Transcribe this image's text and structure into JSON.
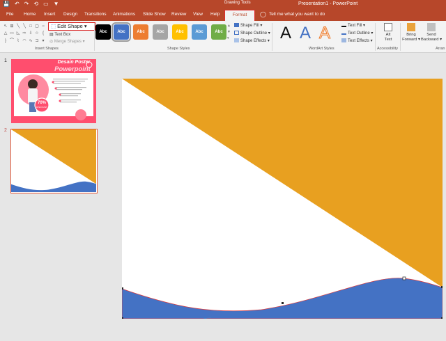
{
  "titlebar": {
    "qat": [
      "💾",
      "↶",
      "↷",
      "⟲",
      "▭",
      "▼"
    ],
    "tools_label": "Drawing Tools",
    "title": "Presentation1 - PowerPoint"
  },
  "tabs": [
    "File",
    "Home",
    "Insert",
    "Design",
    "Transitions",
    "Animations",
    "Slide Show",
    "Review",
    "View",
    "Help"
  ],
  "format_tab": "Format",
  "tell_me": "Tell me what you want to do",
  "ribbon": {
    "insert_shapes": {
      "label": "Insert Shapes",
      "edit_shape": "Edit Shape",
      "text_box": "Text Box",
      "merge_shapes": "Merge Shapes"
    },
    "shape_styles": {
      "label": "Shape Styles",
      "boxes": [
        {
          "text": "Abc",
          "color": "#000000"
        },
        {
          "text": "Abc",
          "color": "#4472c4",
          "selected": true
        },
        {
          "text": "Abc",
          "color": "#ed7d31"
        },
        {
          "text": "Abc",
          "color": "#a5a5a5"
        },
        {
          "text": "Abc",
          "color": "#ffc000"
        },
        {
          "text": "Abc",
          "color": "#5b9bd5"
        },
        {
          "text": "Abc",
          "color": "#70ad47"
        }
      ],
      "fill": "Shape Fill",
      "outline": "Shape Outline",
      "effects": "Shape Effects"
    },
    "wordart": {
      "label": "WordArt Styles",
      "samples": [
        "A",
        "A",
        "A"
      ],
      "text_fill": "Text Fill",
      "text_outline": "Text Outline",
      "text_effects": "Text Effects"
    },
    "accessibility": {
      "label": "Accessibility",
      "alt_text": [
        "Alt",
        "Text"
      ]
    },
    "arrange": {
      "label": "Arran",
      "bring_forward": [
        "Bring",
        "Forward"
      ],
      "send_backward": [
        "Send",
        "Backward"
      ]
    }
  },
  "slides": [
    {
      "number": "1",
      "title1": "Desain Poster",
      "title2": "Powerpoint",
      "badge_percent": "70%",
      "badge_sub": "DISCOUNT"
    },
    {
      "number": "2"
    }
  ],
  "colors": {
    "accent": "#b7472a",
    "gold": "#e8a020",
    "blue": "#4472c4",
    "pink": "#ff4e6e"
  }
}
